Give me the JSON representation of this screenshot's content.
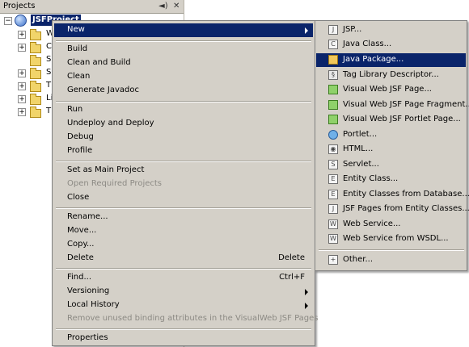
{
  "panel": {
    "title": "Projects",
    "controls": [
      "◄)",
      "✕"
    ],
    "project_name": "JSFProject",
    "tree_letters": [
      "W",
      "C",
      "S",
      "S",
      "T",
      "Li",
      "T"
    ]
  },
  "context_menu": {
    "items": [
      {
        "label": "New",
        "submenu": true,
        "highlighted": true
      },
      {
        "label": "Build"
      },
      {
        "label": "Clean and Build"
      },
      {
        "label": "Clean"
      },
      {
        "label": "Generate Javadoc"
      },
      {
        "label": "Run"
      },
      {
        "label": "Undeploy and Deploy"
      },
      {
        "label": "Debug"
      },
      {
        "label": "Profile"
      },
      {
        "label": "Set as Main Project"
      },
      {
        "label": "Open Required Projects",
        "disabled": true
      },
      {
        "label": "Close"
      },
      {
        "label": "Rename..."
      },
      {
        "label": "Move..."
      },
      {
        "label": "Copy..."
      },
      {
        "label": "Delete",
        "shortcut": "Delete"
      },
      {
        "label": "Find...",
        "shortcut": "Ctrl+F"
      },
      {
        "label": "Versioning",
        "submenu": true
      },
      {
        "label": "Local History",
        "submenu": true
      },
      {
        "label": "Remove unused binding attributes in the VisualWeb JSF Pages",
        "disabled": true
      },
      {
        "label": "Properties"
      }
    ]
  },
  "new_submenu": {
    "items": [
      {
        "label": "JSP...",
        "icon": "jsp-file-icon"
      },
      {
        "label": "Java Class...",
        "icon": "java-class-icon"
      },
      {
        "label": "Java Package...",
        "icon": "java-package-icon",
        "highlighted": true
      },
      {
        "label": "Tag Library Descriptor...",
        "icon": "tag-library-icon"
      },
      {
        "label": "Visual Web JSF Page...",
        "icon": "visual-web-page-icon"
      },
      {
        "label": "Visual Web JSF Page Fragment...",
        "icon": "visual-web-fragment-icon"
      },
      {
        "label": "Visual Web JSF Portlet Page...",
        "icon": "visual-web-portlet-icon"
      },
      {
        "label": "Portlet...",
        "icon": "portlet-icon"
      },
      {
        "label": "HTML...",
        "icon": "html-file-icon"
      },
      {
        "label": "Servlet...",
        "icon": "servlet-icon"
      },
      {
        "label": "Entity Class...",
        "icon": "entity-class-icon"
      },
      {
        "label": "Entity Classes from Database...",
        "icon": "entity-db-icon"
      },
      {
        "label": "JSF Pages from Entity Classes...",
        "icon": "jsf-pages-icon"
      },
      {
        "label": "Web Service...",
        "icon": "web-service-icon"
      },
      {
        "label": "Web Service from WSDL...",
        "icon": "wsdl-service-icon"
      },
      {
        "label": "Other...",
        "icon": "other-file-icon"
      }
    ]
  },
  "colors": {
    "highlight": "#0a246a",
    "menu_bg": "#d4d0c8",
    "disabled_text": "#8c8a84"
  }
}
